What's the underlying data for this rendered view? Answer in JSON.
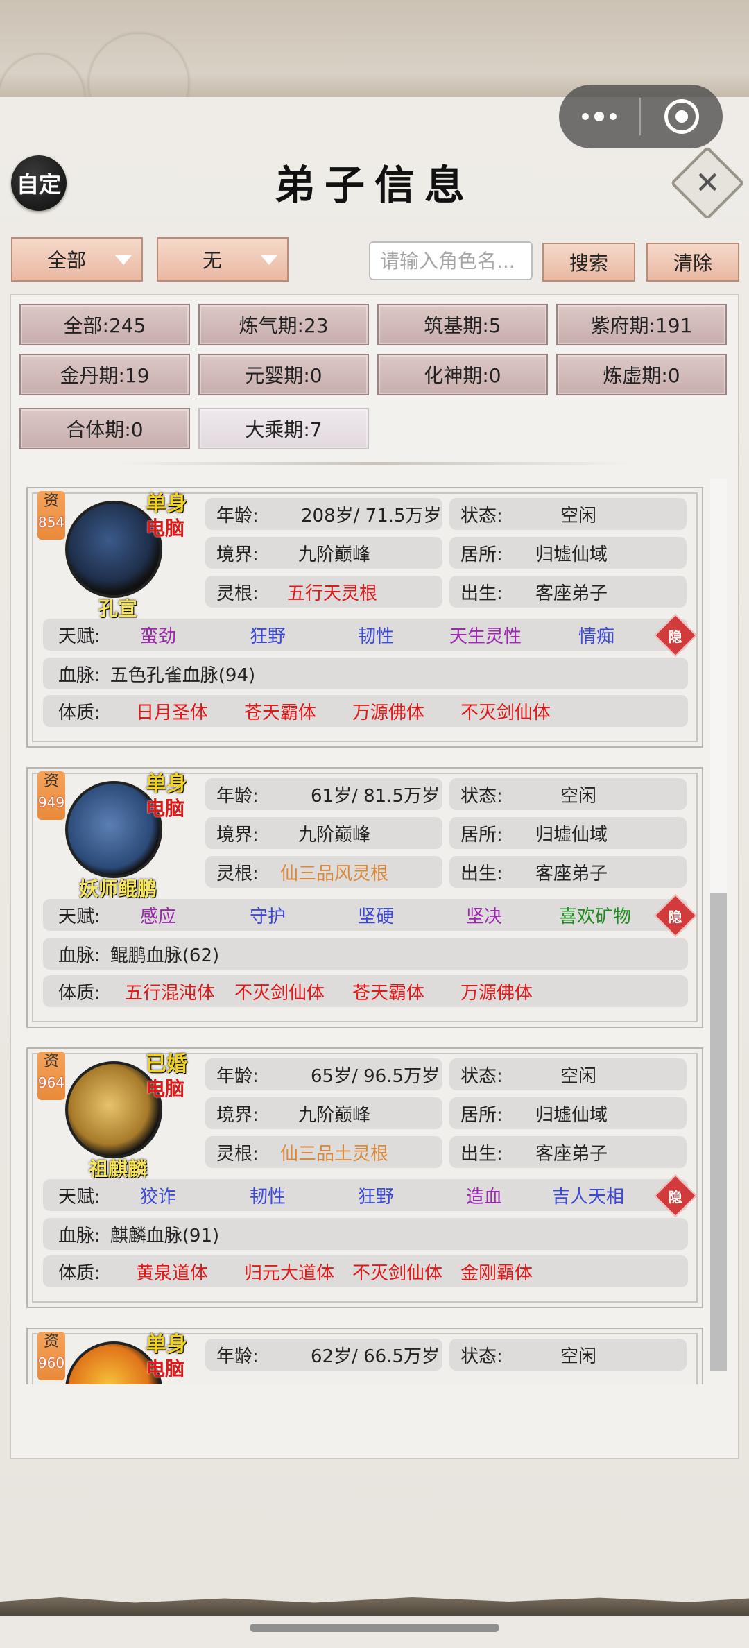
{
  "header": {
    "custom_label": "自定",
    "title": "弟子信息",
    "close_glyph": "✕"
  },
  "filters": {
    "category": "全部",
    "sub": "无",
    "search_placeholder": "请输入角色名...",
    "search_label": "搜索",
    "clear_label": "清除"
  },
  "stages": [
    {
      "label": "全部:245"
    },
    {
      "label": "炼气期:23"
    },
    {
      "label": "筑基期:5"
    },
    {
      "label": "紫府期:191"
    },
    {
      "label": "金丹期:19"
    },
    {
      "label": "元婴期:0"
    },
    {
      "label": "化神期:0"
    },
    {
      "label": "炼虚期:0"
    },
    {
      "label": "合体期:0"
    },
    {
      "label": "大乘期:7"
    }
  ],
  "labels": {
    "age": "年龄:",
    "status": "状态:",
    "realm": "境界:",
    "residence": "居所:",
    "root": "灵根:",
    "birth": "出生:",
    "talent": "天赋:",
    "blood": "血脉:",
    "physique": "体质:",
    "qual": "资",
    "hide": "隐"
  },
  "disciples": [
    {
      "name": "孔宣",
      "qual": "854",
      "marital": "单身",
      "control": "电脑",
      "age": "208岁/ 71.5万岁",
      "status": "空闲",
      "realm": "九阶巅峰",
      "residence": "归墟仙域",
      "root": "五行天灵根",
      "birth": "客座弟子",
      "talents": [
        "蛮劲",
        "狂野",
        "韧性",
        "天生灵性",
        "情痴"
      ],
      "blood": "五色孔雀血脉(94)",
      "physiques": [
        "日月圣体",
        "苍天霸体",
        "万源佛体",
        "不灭剑仙体"
      ]
    },
    {
      "name": "妖师鲲鹏",
      "qual": "949",
      "marital": "单身",
      "control": "电脑",
      "age": "61岁/ 81.5万岁",
      "status": "空闲",
      "realm": "九阶巅峰",
      "residence": "归墟仙域",
      "root": "仙三品风灵根",
      "birth": "客座弟子",
      "talents": [
        "感应",
        "守护",
        "坚硬",
        "坚决",
        "喜欢矿物"
      ],
      "blood": "鲲鹏血脉(62)",
      "physiques": [
        "五行混沌体",
        "不灭剑仙体",
        "苍天霸体",
        "万源佛体"
      ]
    },
    {
      "name": "祖麒麟",
      "qual": "964",
      "marital": "已婚",
      "control": "电脑",
      "age": "65岁/ 96.5万岁",
      "status": "空闲",
      "realm": "九阶巅峰",
      "residence": "归墟仙域",
      "root": "仙三品土灵根",
      "birth": "客座弟子",
      "talents": [
        "狡诈",
        "韧性",
        "狂野",
        "造血",
        "吉人天相"
      ],
      "blood": "麒麟血脉(91)",
      "physiques": [
        "黄泉道体",
        "归元大道体",
        "不灭剑仙体",
        "金刚霸体"
      ]
    },
    {
      "qual": "960",
      "marital": "单身",
      "control": "电脑",
      "age": "62岁/ 66.5万岁",
      "status": "空闲"
    }
  ],
  "colors": {
    "talent_purple": "#9c27b0",
    "talent_blue": "#3b49d6",
    "red": "#e01818",
    "orange": "#d9893c",
    "green": "#1f8a1f"
  }
}
